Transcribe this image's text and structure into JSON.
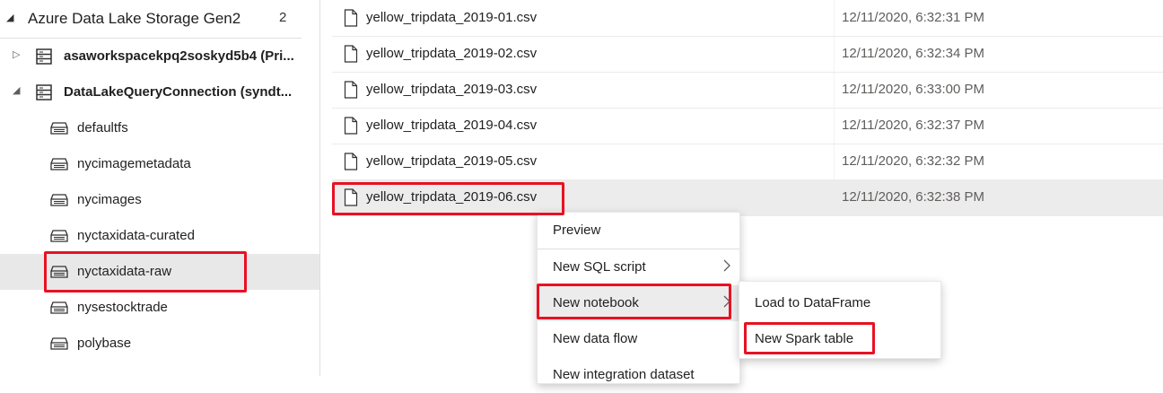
{
  "sidebar": {
    "section_title": "Azure Data Lake Storage Gen2",
    "section_count": "2",
    "accounts": [
      {
        "label": "asaworkspacekpq2soskyd5b4 (Pri..."
      },
      {
        "label": "DataLakeQueryConnection (syndt..."
      }
    ],
    "containers": [
      {
        "label": "defaultfs"
      },
      {
        "label": "nycimagemetadata"
      },
      {
        "label": "nycimages"
      },
      {
        "label": "nyctaxidata-curated"
      },
      {
        "label": "nyctaxidata-raw"
      },
      {
        "label": "nysestocktrade"
      },
      {
        "label": "polybase"
      }
    ]
  },
  "files": [
    {
      "name": "yellow_tripdata_2019-01.csv",
      "modified": "12/11/2020, 6:32:31 PM"
    },
    {
      "name": "yellow_tripdata_2019-02.csv",
      "modified": "12/11/2020, 6:32:34 PM"
    },
    {
      "name": "yellow_tripdata_2019-03.csv",
      "modified": "12/11/2020, 6:33:00 PM"
    },
    {
      "name": "yellow_tripdata_2019-04.csv",
      "modified": "12/11/2020, 6:32:37 PM"
    },
    {
      "name": "yellow_tripdata_2019-05.csv",
      "modified": "12/11/2020, 6:32:32 PM"
    },
    {
      "name": "yellow_tripdata_2019-06.csv",
      "modified": "12/11/2020, 6:32:38 PM"
    }
  ],
  "context_menu": {
    "items": [
      {
        "label": "Preview"
      },
      {
        "label": "New SQL script"
      },
      {
        "label": "New notebook"
      },
      {
        "label": "New data flow"
      },
      {
        "label": "New integration dataset"
      }
    ]
  },
  "submenu": {
    "items": [
      {
        "label": "Load to DataFrame"
      },
      {
        "label": "New Spark table"
      }
    ]
  },
  "colors": {
    "highlight": "#e81123",
    "selected_row": "#e8e8e8"
  }
}
